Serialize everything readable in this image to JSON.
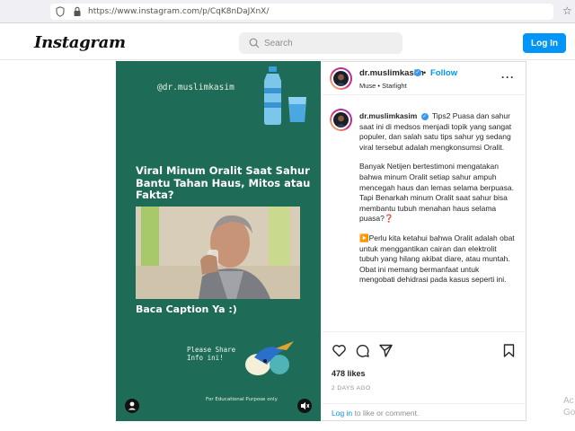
{
  "browser": {
    "url": "https://www.instagram.com/p/CqK8nDaJXnX/"
  },
  "header": {
    "logo": "Instagram",
    "search_placeholder": "Search",
    "login_button": "Log In"
  },
  "media": {
    "handle": "@dr.muslimkasim",
    "headline": "Viral Minum Oralit Saat Sahur Bantu Tahan Haus, Mitos atau Fakta?",
    "cta": "Baca Caption Ya :)",
    "share_line1": "Please Share",
    "share_line2": "Info ini!",
    "edu_note": "For Educational Purpose only"
  },
  "post": {
    "username": "dr.muslimkasim",
    "follow": "Follow",
    "dot": "•",
    "music": "Muse • Starlight",
    "caption_paragraphs": [
      "Tips2 Puasa dan sahur saat ini di medsos menjadi topik yang sangat populer, dan salah satu tips sahur yg sedang viral tersebut adalah mengkonsumsi Oralit.",
      "Banyak Netijen bertestimoni mengatakan bahwa minum Oralit setiap sahur ampuh mencegah haus dan lemas selama berpuasa.",
      "Tapi Benarkah minum Oralit saat sahur bisa membantu tubuh menahan haus selama puasa?❓",
      "▶️Perlu kita ketahui bahwa Oralit adalah obat untuk menggantikan cairan dan elektrolit tubuh yang hilang akibat diare, atau muntah. Obat ini memang bermanfaat untuk mengobati dehidrasi pada kasus seperti ini."
    ],
    "likes": "478 likes",
    "time": "2 DAYS AGO",
    "login_link": "Log in",
    "login_suffix": " to like or comment."
  },
  "os_watermark": {
    "line1": "Ac",
    "line2": "Go"
  },
  "colors": {
    "media_bg": "#1e6b58",
    "accent": "#0095f6",
    "verified": "#3897f0"
  }
}
